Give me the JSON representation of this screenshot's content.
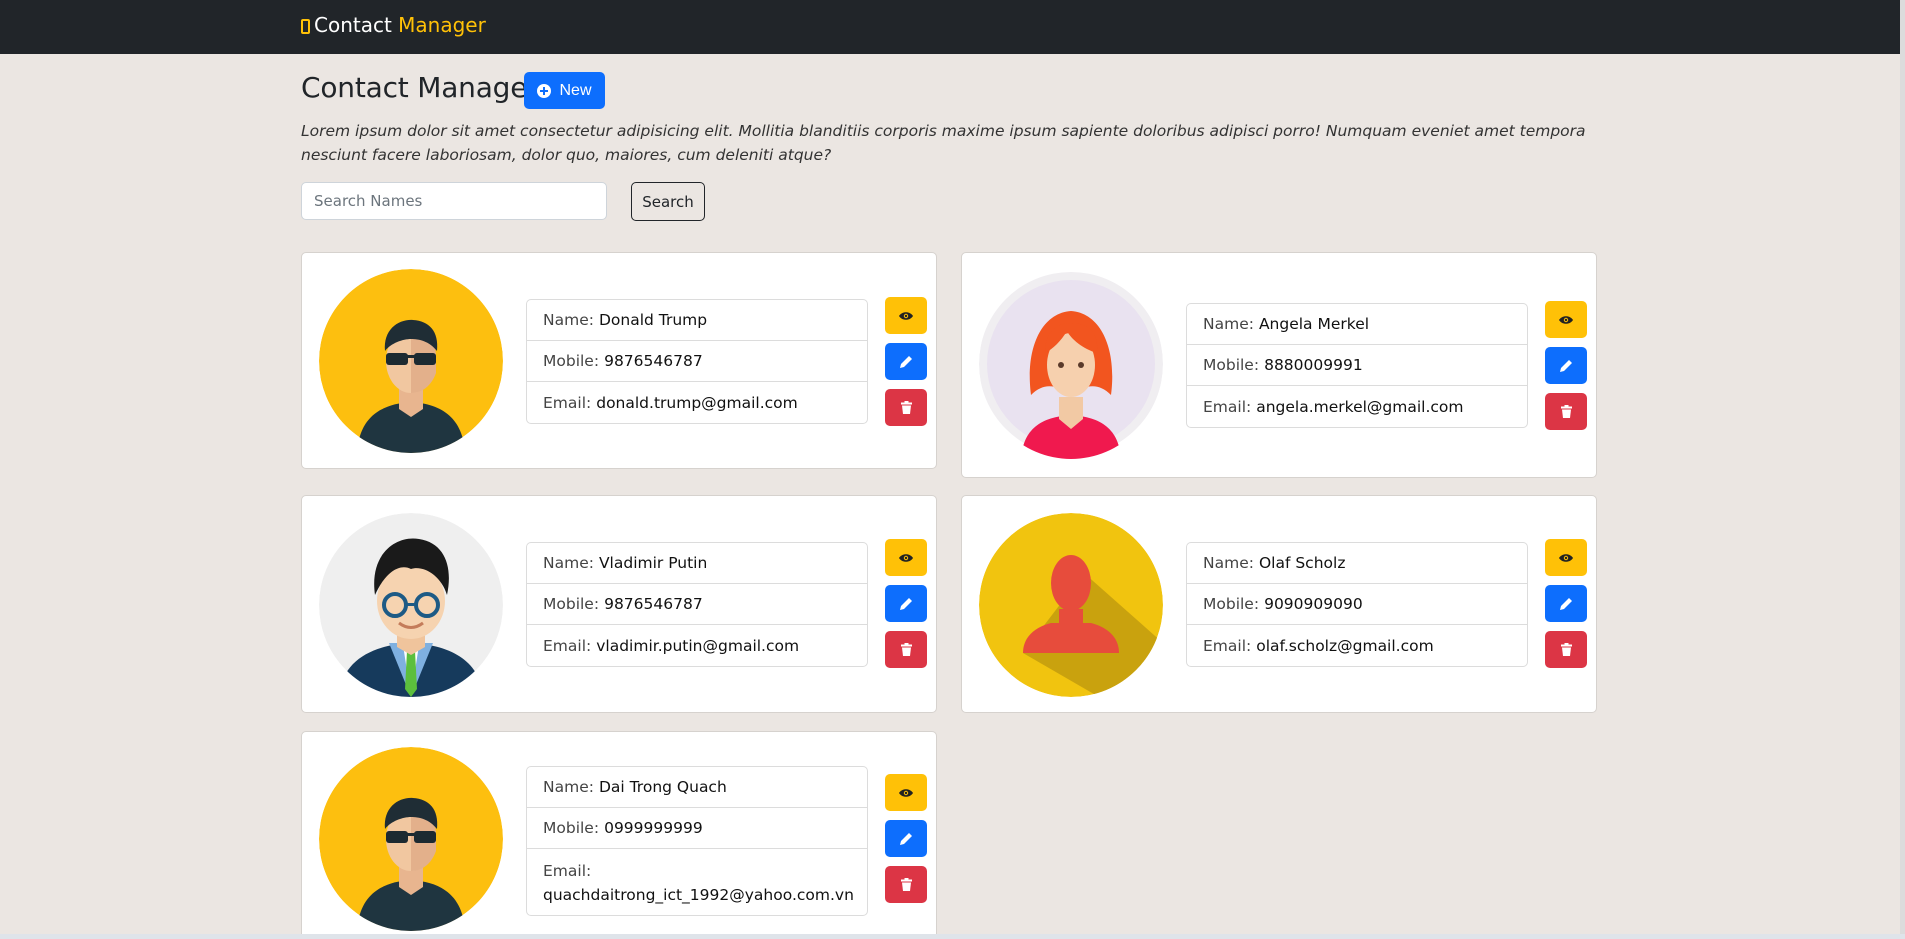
{
  "brand": {
    "prefix": "Contact",
    "accent": "Manager"
  },
  "page": {
    "title": "Contact Manager",
    "new_button": "New",
    "intro": "Lorem ipsum dolor sit amet consectetur adipisicing elit. Mollitia blanditiis corporis maxime ipsum sapiente doloribus adipisci porro! Numquam eveniet amet tempora nesciunt facere laboriosam, dolor quo, maiores, cum deleniti atque?"
  },
  "search": {
    "placeholder": "Search Names",
    "value": "",
    "button": "Search"
  },
  "labels": {
    "name": "Name:",
    "mobile": "Mobile:",
    "email": "Email:"
  },
  "contacts": [
    {
      "name": "Donald Trump",
      "mobile": "9876546787",
      "email": "donald.trump@gmail.com",
      "avatar": "man-sunglasses-avatar"
    },
    {
      "name": "Angela Merkel",
      "mobile": "8880009991",
      "email": "angela.merkel@gmail.com",
      "avatar": "woman-red-hair-avatar"
    },
    {
      "name": "Vladimir Putin",
      "mobile": "9876546787",
      "email": "vladimir.putin@gmail.com",
      "avatar": "man-glasses-suit-avatar"
    },
    {
      "name": "Olaf Scholz",
      "mobile": "9090909090",
      "email": "olaf.scholz@gmail.com",
      "avatar": "user-silhouette-avatar"
    },
    {
      "name": "Dai Trong Quach",
      "mobile": "0999999999",
      "email": "quachdaitrong_ict_1992@yahoo.com.vn",
      "avatar": "man-sunglasses-avatar"
    }
  ],
  "colors": {
    "navbar": "#212529",
    "accent": "#ffc107",
    "primary": "#0d6efd",
    "danger": "#dc3545",
    "background": "#ebe6e2"
  }
}
